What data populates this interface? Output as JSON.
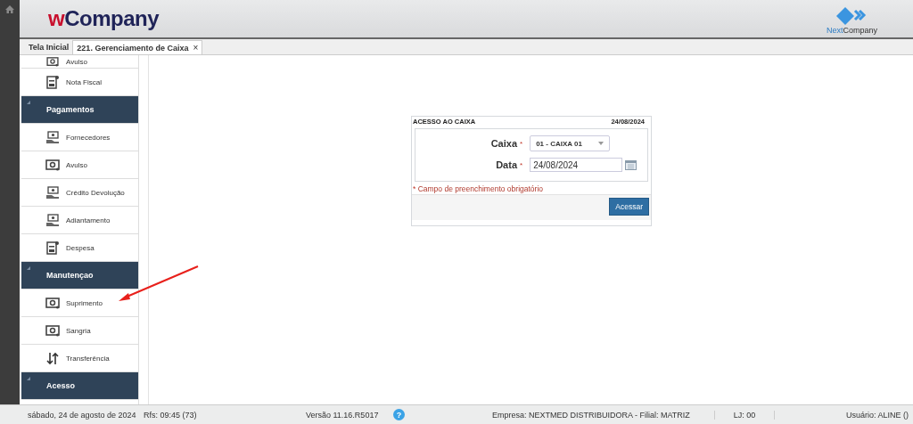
{
  "header": {
    "logo_prefix": "w",
    "logo_rest": "Company",
    "brand_prefix": "Next",
    "brand_rest": "Company"
  },
  "tabs": [
    {
      "label": "Tela Inicial",
      "selected": false
    },
    {
      "label": "221. Gerenciamento de Caixa",
      "selected": true,
      "close": "×"
    }
  ],
  "sidebar": {
    "items": [
      {
        "kind": "item",
        "label": "Avulso"
      },
      {
        "kind": "item",
        "label": "Nota Fiscal"
      },
      {
        "kind": "header",
        "label": "Pagamentos"
      },
      {
        "kind": "item",
        "label": "Fornecedores"
      },
      {
        "kind": "item",
        "label": "Avulso"
      },
      {
        "kind": "item",
        "label": "Crédito Devolução"
      },
      {
        "kind": "item",
        "label": "Adiantamento"
      },
      {
        "kind": "item",
        "label": "Despesa"
      },
      {
        "kind": "header",
        "label": "Manutençao"
      },
      {
        "kind": "item",
        "label": "Suprimento"
      },
      {
        "kind": "item",
        "label": "Sangria"
      },
      {
        "kind": "item",
        "label": "Transferência"
      },
      {
        "kind": "header",
        "label": "Acesso"
      }
    ]
  },
  "dialog": {
    "title": "ACESSO AO CAIXA",
    "date": "24/08/2024",
    "fields": [
      {
        "kind": "select",
        "label": "Caixa",
        "required": "*",
        "value": "01 - CAIXA 01"
      },
      {
        "kind": "date",
        "label": "Data",
        "required": "*",
        "value": "24/08/2024"
      }
    ],
    "note_mark": "*",
    "note": "Campo de preenchimento obrigatório",
    "button": "Acessar"
  },
  "status_bar": {
    "date": "sábado, 24 de agosto de 2024",
    "rfs": "Rfs: 09:45 (73)",
    "version": "Versão 11.16.R5017",
    "help": "?",
    "company": "Empresa: NEXTMED DISTRIBUIDORA - Filial: MATRIZ",
    "store": "LJ: 00",
    "user": "Usuário: ALINE ()"
  }
}
